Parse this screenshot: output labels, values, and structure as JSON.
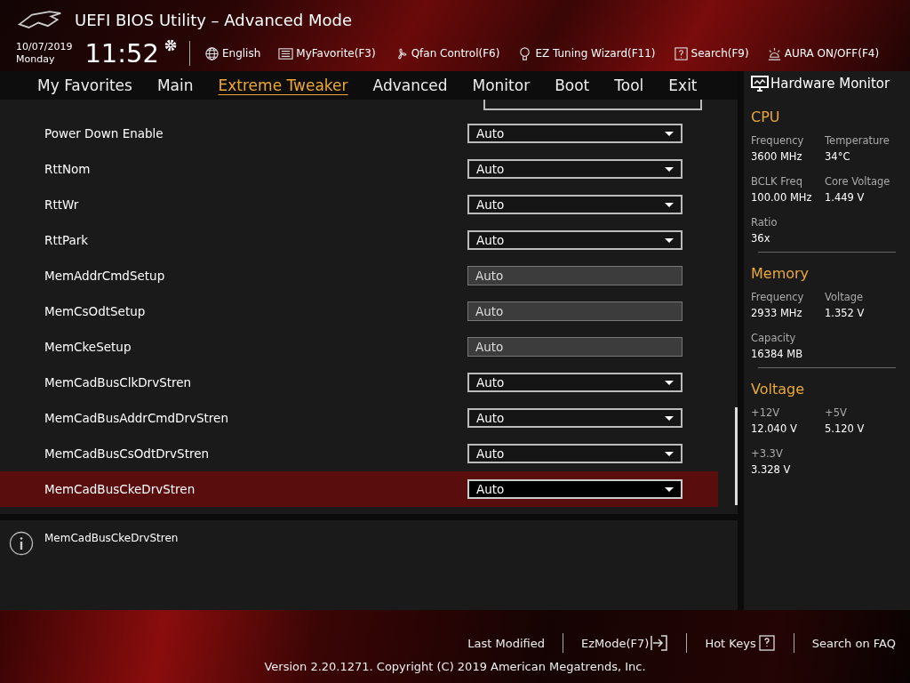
{
  "window": {
    "title": "UEFI BIOS Utility – Advanced Mode"
  },
  "clock": {
    "date": "10/07/2019",
    "day": "Monday",
    "time": "11:52"
  },
  "toolbar": [
    {
      "kind": "globe",
      "label": "English"
    },
    {
      "kind": "list",
      "label": "MyFavorite(F3)"
    },
    {
      "kind": "fan",
      "label": "Qfan Control(F6)"
    },
    {
      "kind": "bulb",
      "label": "EZ Tuning Wizard(F11)"
    },
    {
      "kind": "help",
      "label": "Search(F9)"
    },
    {
      "kind": "aura",
      "label": "AURA ON/OFF(F4)"
    }
  ],
  "tabs": [
    {
      "label": "My Favorites",
      "selected": false
    },
    {
      "label": "Main",
      "selected": false
    },
    {
      "label": "Extreme Tweaker",
      "selected": true
    },
    {
      "label": "Advanced",
      "selected": false
    },
    {
      "label": "Monitor",
      "selected": false
    },
    {
      "label": "Boot",
      "selected": false
    },
    {
      "label": "Tool",
      "selected": false
    },
    {
      "label": "Exit",
      "selected": false
    }
  ],
  "settings": [
    {
      "label": "Power Down Enable",
      "value": "Auto",
      "disabled": false,
      "selected": false
    },
    {
      "label": "RttNom",
      "value": "Auto",
      "disabled": false,
      "selected": false
    },
    {
      "label": "RttWr",
      "value": "Auto",
      "disabled": false,
      "selected": false
    },
    {
      "label": "RttPark",
      "value": "Auto",
      "disabled": false,
      "selected": false
    },
    {
      "label": "MemAddrCmdSetup",
      "value": "Auto",
      "disabled": true,
      "selected": false
    },
    {
      "label": "MemCsOdtSetup",
      "value": "Auto",
      "disabled": true,
      "selected": false
    },
    {
      "label": "MemCkeSetup",
      "value": "Auto",
      "disabled": true,
      "selected": false
    },
    {
      "label": "MemCadBusClkDrvStren",
      "value": "Auto",
      "disabled": false,
      "selected": false
    },
    {
      "label": "MemCadBusAddrCmdDrvStren",
      "value": "Auto",
      "disabled": false,
      "selected": false
    },
    {
      "label": "MemCadBusCsOdtDrvStren",
      "value": "Auto",
      "disabled": false,
      "selected": false
    },
    {
      "label": "MemCadBusCkeDrvStren",
      "value": "Auto",
      "disabled": false,
      "selected": true
    }
  ],
  "help": {
    "text": "MemCadBusCkeDrvStren"
  },
  "hardware_monitor": {
    "title": "Hardware Monitor",
    "sections": [
      {
        "title": "CPU",
        "items": [
          {
            "label": "Frequency",
            "value": "3600 MHz"
          },
          {
            "label": "Temperature",
            "value": "34°C"
          },
          {
            "label": "BCLK Freq",
            "value": "100.00 MHz"
          },
          {
            "label": "Core Voltage",
            "value": "1.449 V"
          },
          {
            "label": "Ratio",
            "value": "36x"
          }
        ]
      },
      {
        "title": "Memory",
        "items": [
          {
            "label": "Frequency",
            "value": "2933 MHz"
          },
          {
            "label": "Voltage",
            "value": "1.352 V"
          },
          {
            "label": "Capacity",
            "value": "16384 MB"
          }
        ]
      },
      {
        "title": "Voltage",
        "items": [
          {
            "label": "+12V",
            "value": "12.040 V"
          },
          {
            "label": "+5V",
            "value": "5.120 V"
          },
          {
            "label": "+3.3V",
            "value": "3.328 V"
          }
        ]
      }
    ]
  },
  "footer": {
    "links": [
      {
        "kind": "text",
        "label": "Last Modified"
      },
      {
        "kind": "exit",
        "label": "EzMode(F7)"
      },
      {
        "kind": "help",
        "label": "Hot Keys"
      },
      {
        "kind": "text",
        "label": "Search on FAQ"
      }
    ],
    "copyright": "Version 2.20.1271. Copyright (C) 2019 American Megatrends, Inc."
  }
}
